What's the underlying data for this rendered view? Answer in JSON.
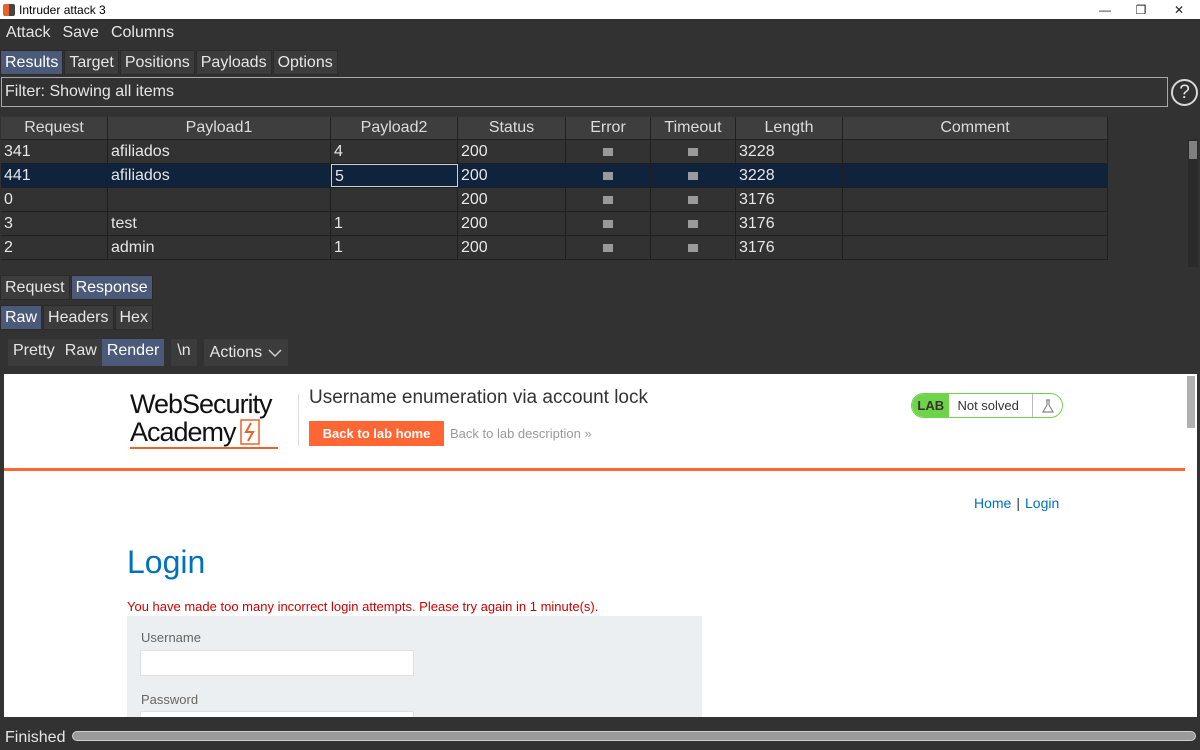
{
  "window": {
    "title": "Intruder attack 3",
    "minimize": "—",
    "restore": "❐",
    "close": "✕"
  },
  "menu": [
    "Attack",
    "Save",
    "Columns"
  ],
  "main_tabs": [
    {
      "label": "Results",
      "active": true
    },
    {
      "label": "Target",
      "active": false
    },
    {
      "label": "Positions",
      "active": false
    },
    {
      "label": "Payloads",
      "active": false
    },
    {
      "label": "Options",
      "active": false
    }
  ],
  "filter": {
    "text": "Filter: Showing all items",
    "help": "?"
  },
  "results_table": {
    "columns": [
      "Request",
      "Payload1",
      "Payload2",
      "Status",
      "Error",
      "Timeout",
      "Length",
      "Comment"
    ],
    "rows": [
      {
        "request": "341",
        "payload1": "afiliados",
        "payload2": "4",
        "status": "200",
        "length": "3228",
        "selected": false
      },
      {
        "request": "441",
        "payload1": "afiliados",
        "payload2": "5",
        "status": "200",
        "length": "3228",
        "selected": true
      },
      {
        "request": "0",
        "payload1": "",
        "payload2": "",
        "status": "200",
        "length": "3176",
        "selected": false
      },
      {
        "request": "3",
        "payload1": "test",
        "payload2": "1",
        "status": "200",
        "length": "3176",
        "selected": false
      },
      {
        "request": "2",
        "payload1": "admin",
        "payload2": "1",
        "status": "200",
        "length": "3176",
        "selected": false
      }
    ]
  },
  "message_tabs": [
    {
      "label": "Request",
      "active": false
    },
    {
      "label": "Response",
      "active": true
    }
  ],
  "view_tabs": [
    {
      "label": "Raw",
      "active": true
    },
    {
      "label": "Headers",
      "active": false
    },
    {
      "label": "Hex",
      "active": false
    }
  ],
  "render_toolbar": {
    "pretty": "Pretty",
    "raw": "Raw",
    "render": "Render",
    "newline": "\\n",
    "actions": "Actions"
  },
  "page": {
    "logo_line1": "WebSecurity",
    "logo_line2": "Academy",
    "heading": "Username enumeration via account lock",
    "back_home": "Back to lab home",
    "back_desc": "Back to lab description",
    "lab_badge": "LAB",
    "lab_status": "Not solved",
    "nav_home": "Home",
    "nav_sep": "|",
    "nav_login": "Login",
    "login_title": "Login",
    "error_message": "You have made too many incorrect login attempts. Please try again in 1 minute(s).",
    "username_label": "Username",
    "password_label": "Password"
  },
  "status": {
    "text": "Finished",
    "progress_fraction": 1.0
  }
}
